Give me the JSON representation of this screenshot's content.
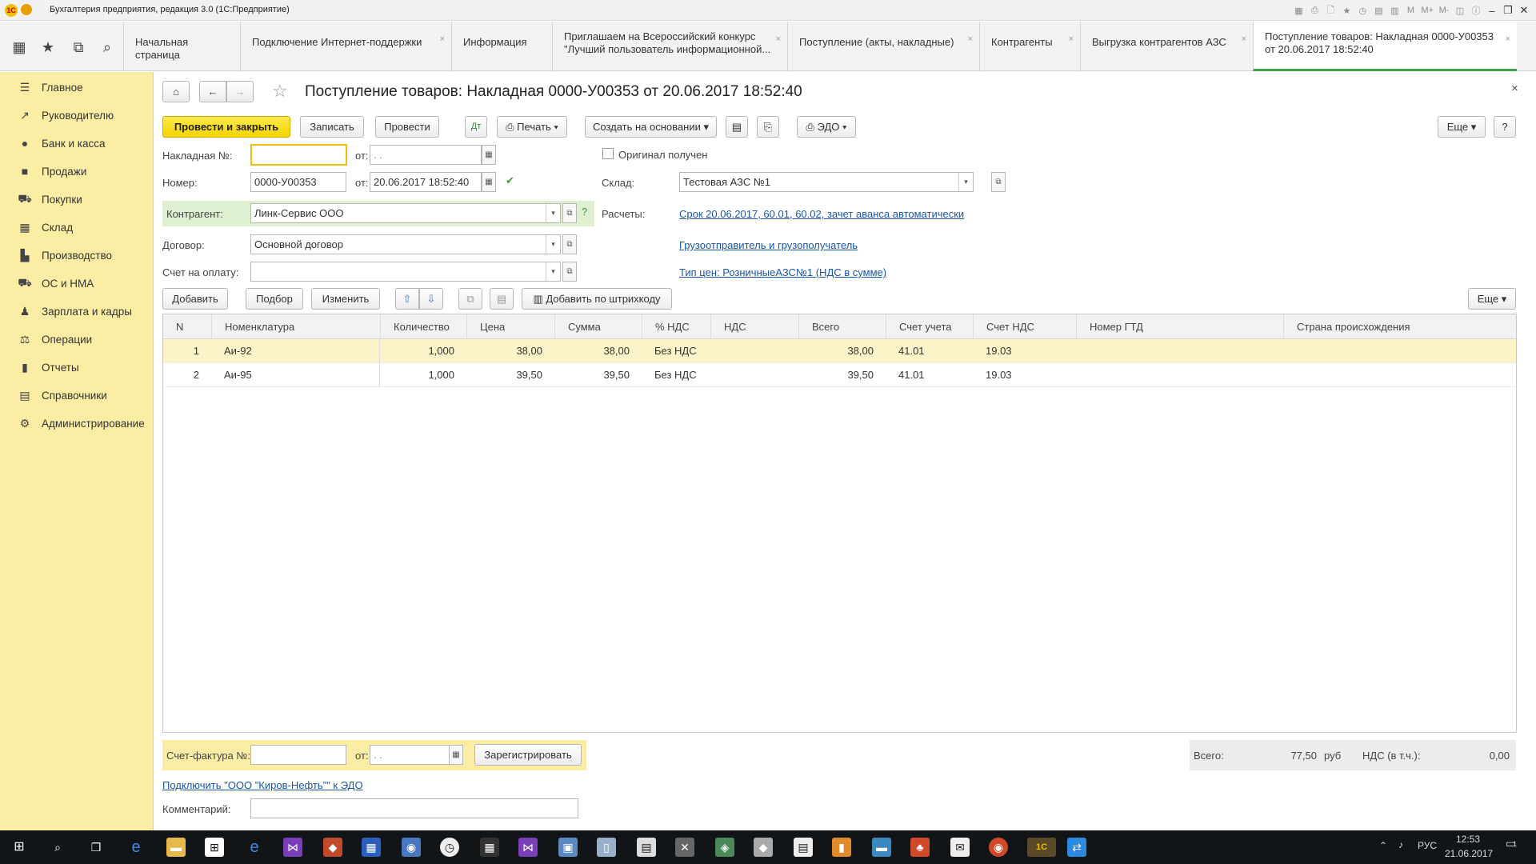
{
  "window": {
    "title": "Бухгалтерия предприятия, редакция 3.0  (1С:Предприятие)"
  },
  "tabs": [
    {
      "label": "Начальная страница"
    },
    {
      "label": "Подключение Интернет-поддержки"
    },
    {
      "label": "Информация"
    },
    {
      "label": "Приглашаем на Всероссийский конкурс \"Лучший пользователь информационной..."
    },
    {
      "label": "Поступление (акты, накладные)"
    },
    {
      "label": "Контрагенты"
    },
    {
      "label": "Выгрузка контрагентов АЗС"
    },
    {
      "label": "Поступление товаров: Накладная 0000-У00353 от 20.06.2017 18:52:40"
    }
  ],
  "sidebar": {
    "items": [
      {
        "label": "Главное",
        "icon": "menu-icon"
      },
      {
        "label": "Руководителю",
        "icon": "trend-icon"
      },
      {
        "label": "Банк и касса",
        "icon": "coins-icon"
      },
      {
        "label": "Продажи",
        "icon": "bag-icon"
      },
      {
        "label": "Покупки",
        "icon": "cart-icon"
      },
      {
        "label": "Склад",
        "icon": "warehouse-icon"
      },
      {
        "label": "Производство",
        "icon": "factory-icon"
      },
      {
        "label": "ОС и НМА",
        "icon": "truck-icon"
      },
      {
        "label": "Зарплата и кадры",
        "icon": "person-icon"
      },
      {
        "label": "Операции",
        "icon": "operations-icon"
      },
      {
        "label": "Отчеты",
        "icon": "bar-chart-icon"
      },
      {
        "label": "Справочники",
        "icon": "book-icon"
      },
      {
        "label": "Администрирование",
        "icon": "gear-icon"
      }
    ]
  },
  "document": {
    "title": "Поступление товаров: Накладная 0000-У00353 от 20.06.2017 18:52:40",
    "toolbar": {
      "post_close": "Провести и закрыть",
      "save": "Записать",
      "post": "Провести",
      "print": "Печать",
      "create_based": "Создать на основании",
      "edo": "ЭДО",
      "more": "Еще",
      "help": "?"
    },
    "fields": {
      "invoice_no_label": "Накладная №:",
      "invoice_no_value": "",
      "from_label": "от:",
      "invoice_date_value": " .  .",
      "number_label": "Номер:",
      "number_value": "0000-У00353",
      "date_value": "20.06.2017 18:52:40",
      "original_label": "Оригинал получен",
      "warehouse_label": "Склад:",
      "warehouse_value": "Тестовая АЗС №1",
      "counterparty_label": "Контрагент:",
      "counterparty_value": "Линк-Сервис ООО",
      "settlements_label": "Расчеты:",
      "settlements_link": "Срок 20.06.2017, 60.01, 60.02, зачет аванса автоматически",
      "contract_label": "Договор:",
      "contract_value": "Основной договор",
      "shipper_link": "Грузоотправитель и грузополучатель",
      "invoice_pay_label": "Счет на оплату:",
      "invoice_pay_value": "",
      "price_type_link": "Тип цен: РозничныеАЗС№1 (НДС в сумме)"
    },
    "table_toolbar": {
      "add": "Добавить",
      "select": "Подбор",
      "change": "Изменить",
      "barcode": "Добавить по штрихкоду",
      "more": "Еще"
    },
    "table": {
      "columns": [
        "N",
        "Номенклатура",
        "Количество",
        "Цена",
        "Сумма",
        "% НДС",
        "НДС",
        "Всего",
        "Счет учета",
        "Счет НДС",
        "Номер ГТД",
        "Страна происхождения"
      ],
      "rows": [
        {
          "n": "1",
          "item": "Аи-92",
          "qty": "1,000",
          "price": "38,00",
          "sum": "38,00",
          "vat_rate": "Без НДС",
          "vat": "",
          "total": "38,00",
          "account": "41.01",
          "vat_account": "19.03",
          "gtd": "",
          "country": ""
        },
        {
          "n": "2",
          "item": "Аи-95",
          "qty": "1,000",
          "price": "39,50",
          "sum": "39,50",
          "vat_rate": "Без НДС",
          "vat": "",
          "total": "39,50",
          "account": "41.01",
          "vat_account": "19.03",
          "gtd": "",
          "country": ""
        }
      ]
    },
    "footer": {
      "sf_label": "Счет-фактура №:",
      "sf_value": "",
      "sf_from_label": "от:",
      "sf_date_value": " .  .",
      "register": "Зарегистрировать",
      "edo_link": "Подключить \"ООО \"Киров-Нефть\"\" к ЭДО",
      "comment_label": "Комментарий:",
      "comment_value": "",
      "total_label": "Всего:",
      "total_value": "77,50",
      "currency": "руб",
      "vat_label": "НДС (в т.ч.):",
      "vat_value": "0,00"
    }
  },
  "taskbar": {
    "lang": "РУС",
    "time": "12:53",
    "date": "21.06.2017",
    "notif": "1"
  }
}
